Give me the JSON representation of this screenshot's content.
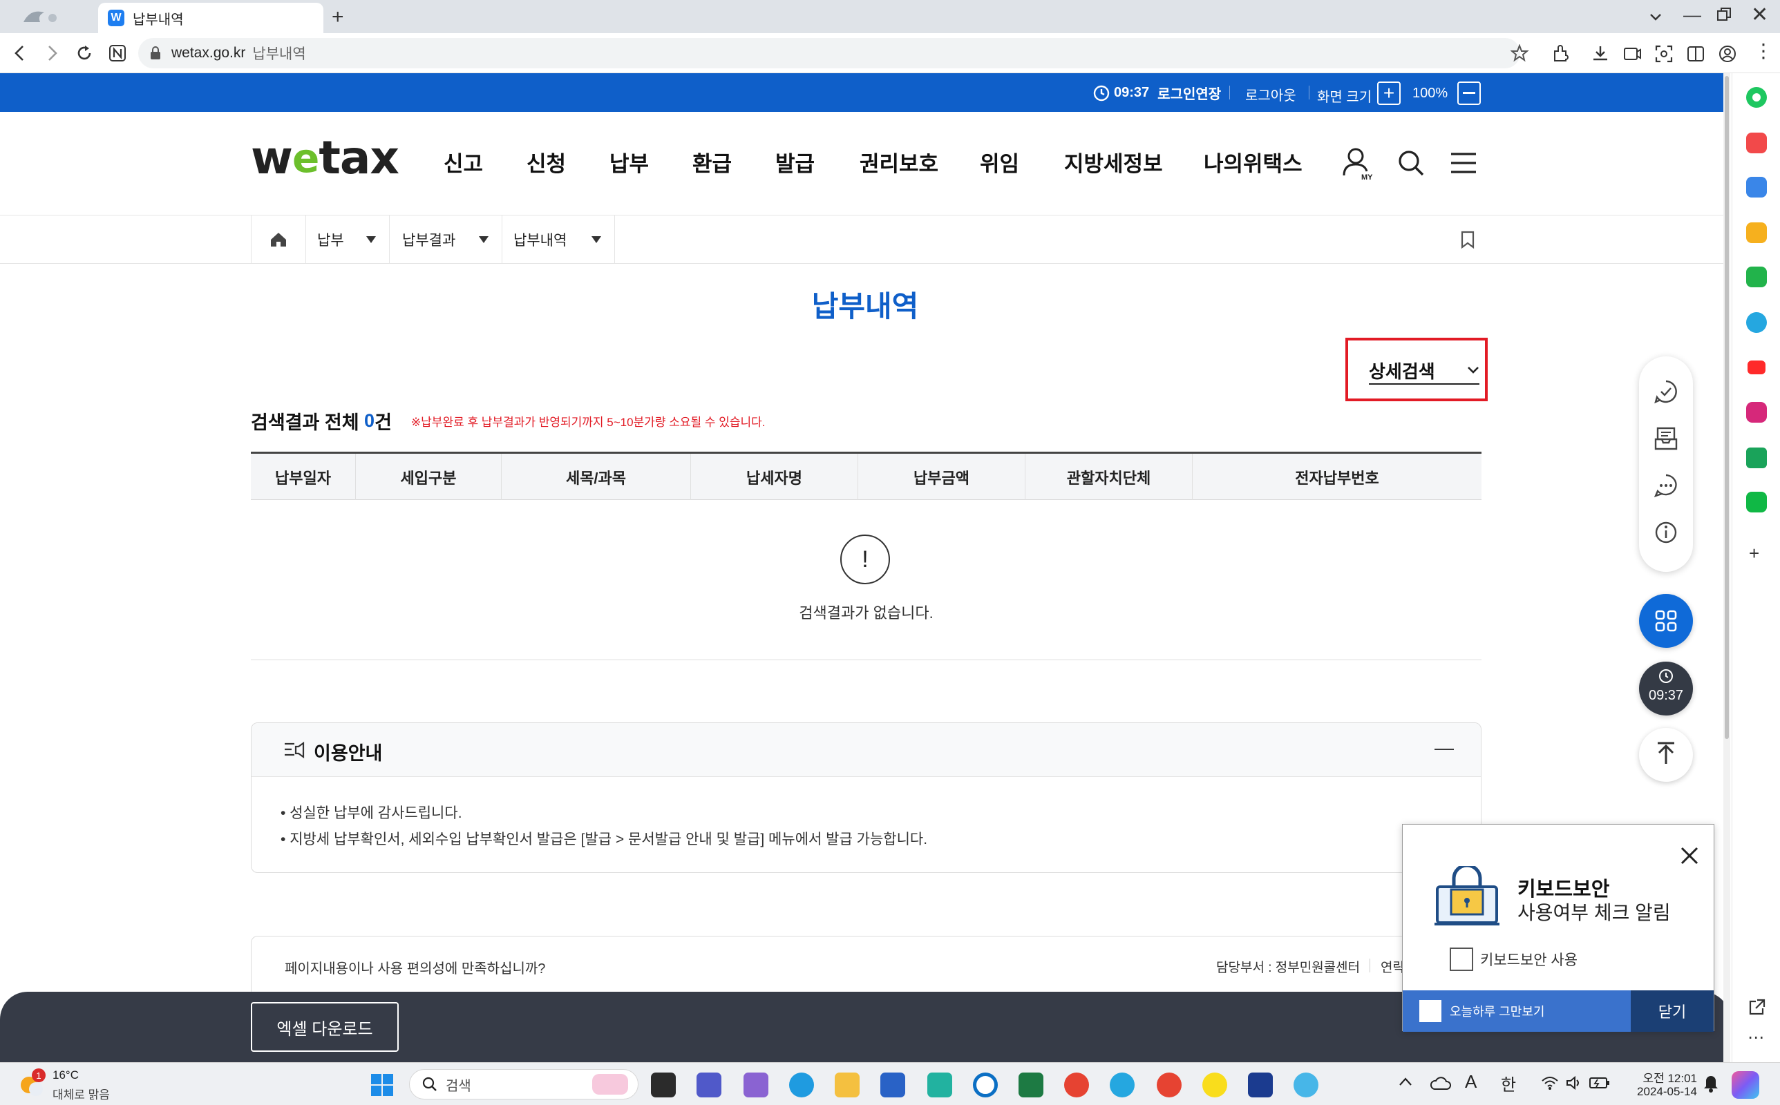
{
  "browser": {
    "tab_title": "납부내역",
    "url_domain": "wetax.go.kr",
    "url_title": "납부내역"
  },
  "topbar": {
    "session_time": "09:37",
    "extend_label": "로그인연장",
    "logout_label": "로그아웃",
    "screen_size_label": "화면 크기",
    "zoom": "100%"
  },
  "gnb": {
    "logo": "wetax",
    "menus": [
      "신고",
      "신청",
      "납부",
      "환급",
      "발급",
      "권리보호",
      "위임",
      "지방세정보",
      "나의위택스"
    ]
  },
  "breadcrumb": {
    "items": [
      "납부",
      "납부결과",
      "납부내역"
    ]
  },
  "main": {
    "page_title": "납부내역",
    "detail_search_label": "상세검색",
    "result_prefix": "검색결과 전체 ",
    "result_count": "0",
    "result_suffix": "건",
    "notice": "※납부완료 후 납부결과가 반영되기까지 5~10분가량 소요될 수 있습니다.",
    "columns": [
      "납부일자",
      "세입구분",
      "세목/과목",
      "납세자명",
      "납부금액",
      "관할자치단체",
      "전자납부번호"
    ],
    "empty_icon_text": "!",
    "empty_text": "검색결과가 없습니다."
  },
  "guide": {
    "title": "이용안내",
    "collapse_symbol": "—",
    "items": [
      "성실한 납부에 감사드립니다.",
      "지방세 납부확인서, 세외수입 납부확인서 발급은 [발급 > 문서발급 안내 및 발급] 메뉴에서 발급 가능합니다."
    ]
  },
  "survey": {
    "question": "페이지내용이나 사용 편의성에 만족하십니까?",
    "dept": "담당부서 : 정부민원콜센터",
    "contact": "연락"
  },
  "bottom": {
    "excel_label": "엑셀 다운로드"
  },
  "quick": {
    "timer": "09:37"
  },
  "kb_popup": {
    "title": "키보드보안",
    "subtitle": "사용여부 체크 알림",
    "checkbox_label": "키보드보안 사용",
    "today_label": "오늘하루 그만보기",
    "close_label": "닫기"
  },
  "taskbar": {
    "weather_temp": "16°C",
    "weather_desc": "대체로 맑음",
    "weather_badge": "1",
    "search_placeholder": "검색",
    "ime": "한",
    "font_a": "A",
    "time": "오전 12:01",
    "date": "2024-05-14"
  },
  "colors": {
    "brand_blue": "#0f5fc9",
    "alert_red": "#e21b25",
    "dark_bar": "#363b47"
  }
}
